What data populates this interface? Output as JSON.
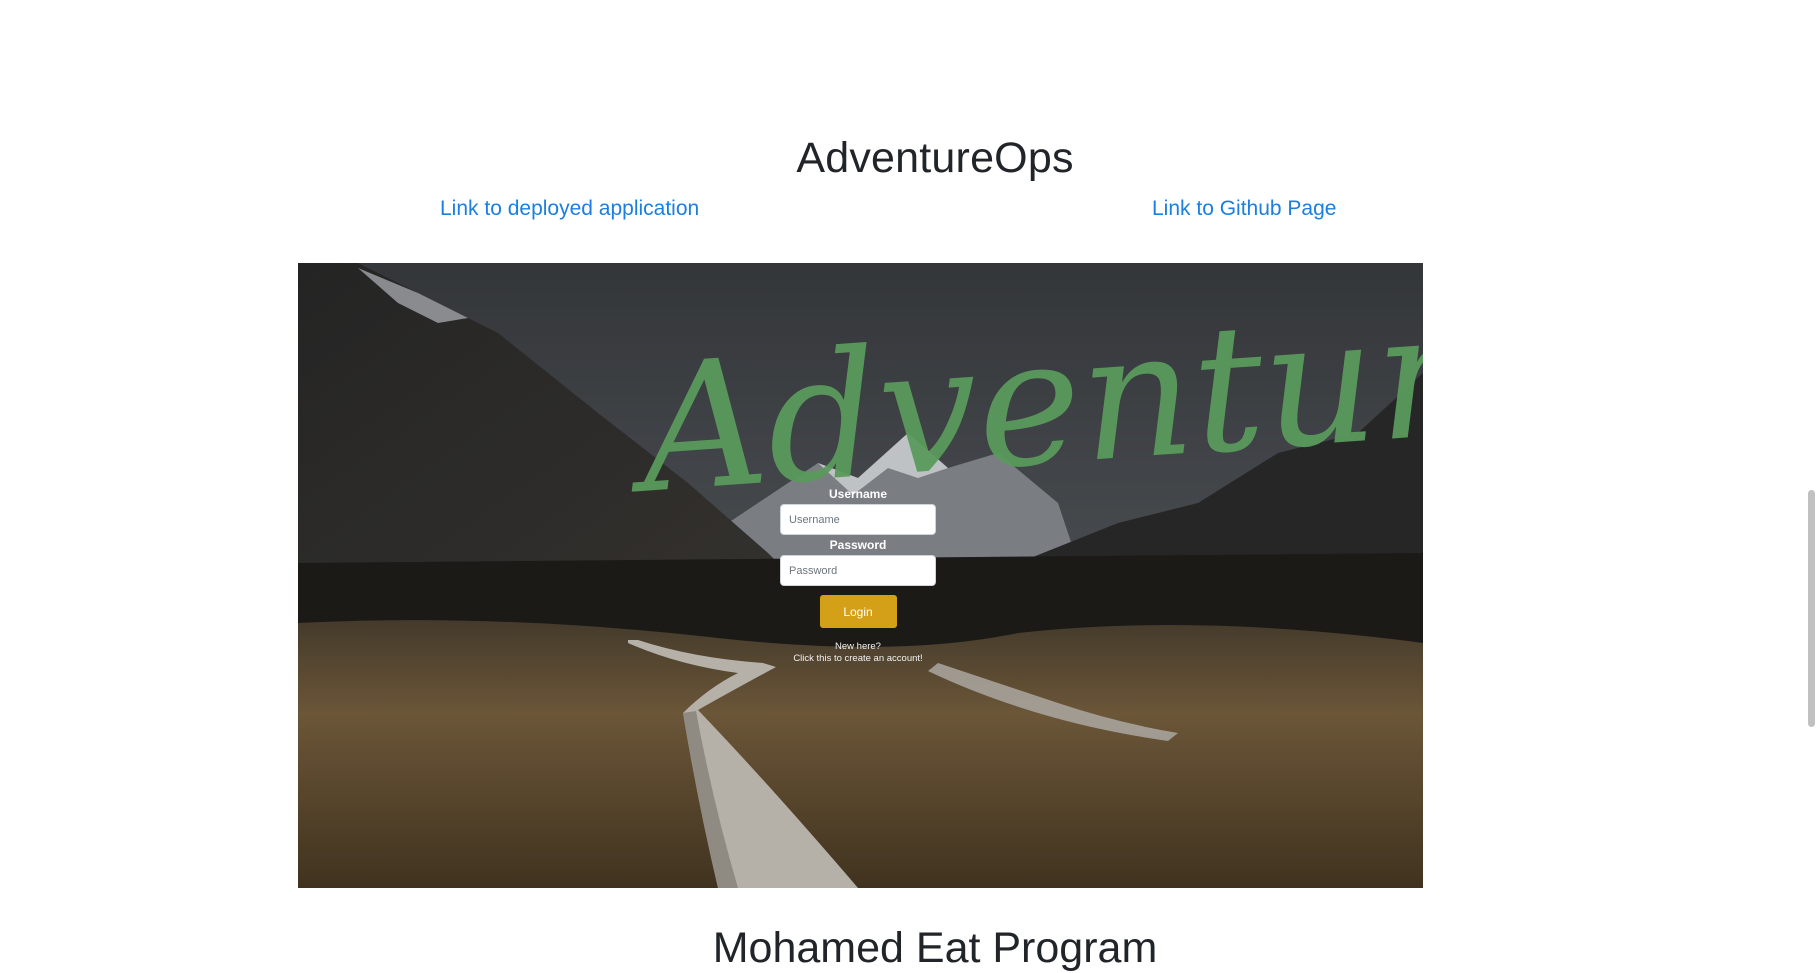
{
  "project": {
    "title": "AdventureOps",
    "deployed_link_label": "Link to deployed application",
    "github_link_label": "Link to Github Page",
    "link_color": "#1a7fe0"
  },
  "screenshot": {
    "logo_text": "Adventureops",
    "logo_color": "#5a9a5c",
    "login": {
      "username_label": "Username",
      "username_placeholder": "Username",
      "password_label": "Password",
      "password_placeholder": "Password",
      "button_label": "Login",
      "button_color": "#d4a018",
      "new_here": "New here?",
      "create_account": "Click this to create an account!"
    }
  },
  "next_section": {
    "title": "Mohamed Eat Program"
  },
  "scrollbar": {
    "thumb_color": "#c1c1c1"
  }
}
